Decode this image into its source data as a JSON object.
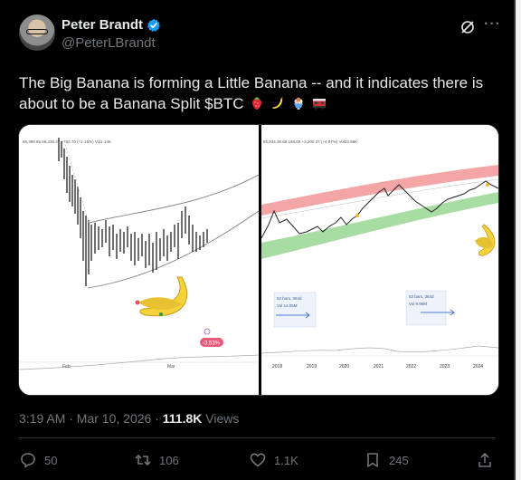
{
  "author": {
    "name": "Peter Brandt",
    "handle": "@PeterLBrandt"
  },
  "tweet": {
    "text": "The Big Banana is forming a Little Banana -- and it indicates there is about to be a Banana Split $BTC",
    "emojis": [
      "strawberry",
      "banana",
      "ice-cream",
      "train-car"
    ]
  },
  "left_chart": {
    "header": "68,399.85  69,239.47 +792.70 (+1.16%)  Vol1.14K",
    "x_labels": [
      "Feb",
      "Mar"
    ],
    "badge": "-3.53%"
  },
  "right_chart": {
    "header": "65,834.38  69,189.69 +3,200.37 (+4.87%)  Vol23.69K",
    "annotation_1": {
      "line1": "52 bars, 364d",
      "line2": "Vol 14.06M"
    },
    "annotation_2": {
      "line1": "52 bars, 364d",
      "line2": "Vol 9.96M"
    },
    "x_labels": [
      "2018",
      "2019",
      "2020",
      "2021",
      "2022",
      "2023",
      "2024"
    ]
  },
  "meta": {
    "timestamp": "3:19 AM · Mar 10, 2026 · ",
    "views_count": "111.8K",
    "views_label": " Views"
  },
  "actions": {
    "replies": "50",
    "reposts": "106",
    "likes": "1.1K",
    "bookmarks": "245"
  },
  "colors": {
    "background": "#000000",
    "text": "#e7e9ea",
    "muted": "#71767b",
    "verified": "#1d9bf0",
    "red_band": "#f4a6a6",
    "green_band": "#a7dca3"
  }
}
